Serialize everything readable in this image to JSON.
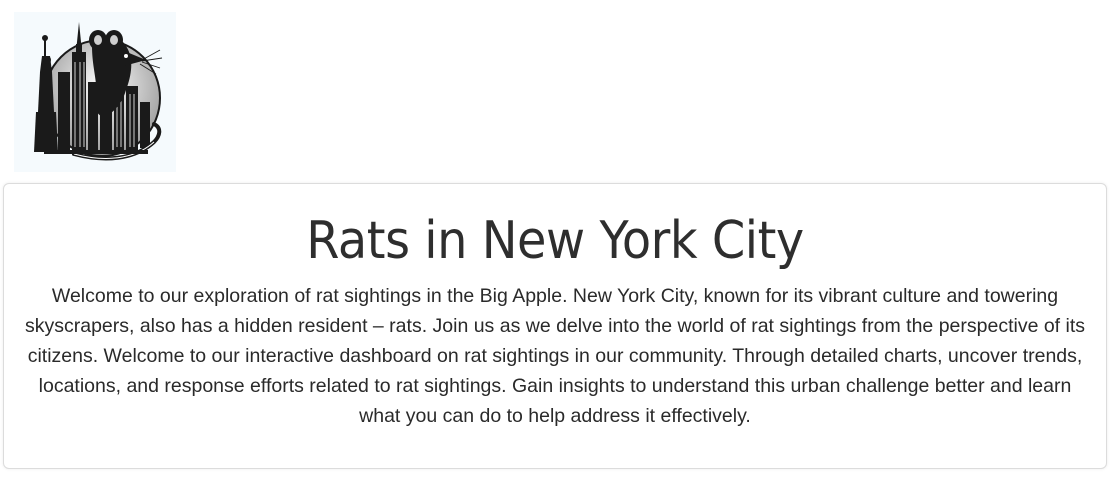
{
  "logo": {
    "icon": "rat-skyline-logo-icon"
  },
  "main": {
    "title": "Rats in New York City",
    "intro": "Welcome to our exploration of rat sightings in the Big Apple. New York City, known for its vibrant culture and towering skyscrapers, also has a hidden resident – rats. Join us as we delve into the world of rat sightings from the perspective of its citizens. Welcome to our interactive dashboard on rat sightings in our community. Through detailed charts, uncover trends, locations, and response efforts related to rat sightings. Gain insights to understand this urban challenge better and learn what you can do to help address it effectively."
  },
  "colors": {
    "logo_background": "#f5fafd",
    "ink": "#1a1a1a",
    "card_border": "#dcdcdc",
    "title_text": "#2e2e2e",
    "body_text": "#2a2a2a"
  }
}
